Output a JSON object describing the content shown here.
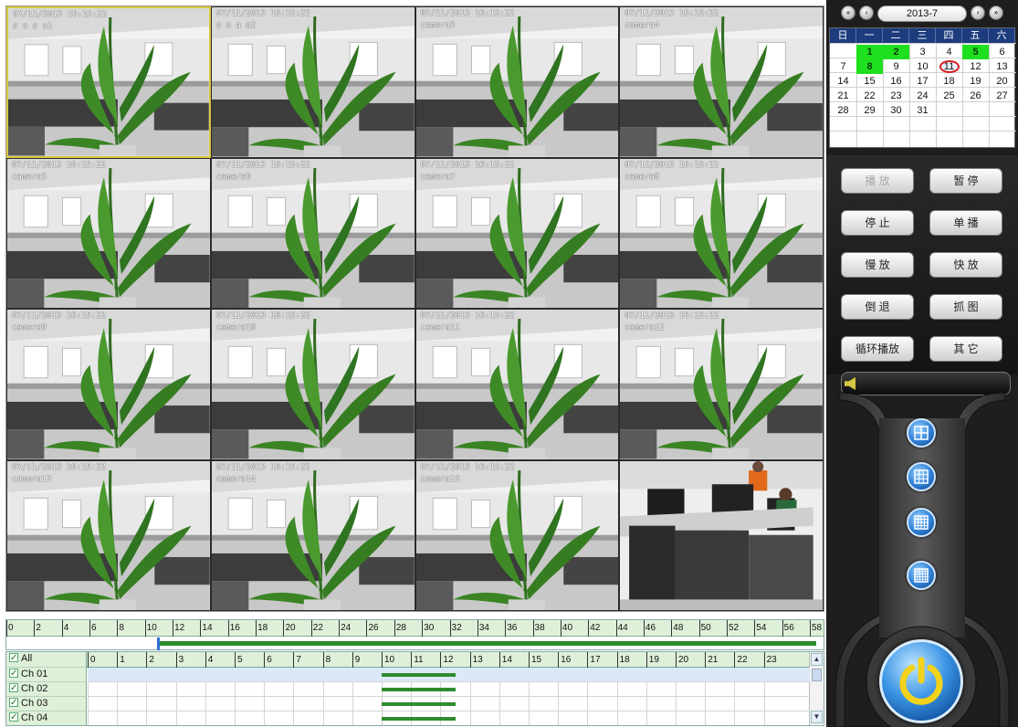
{
  "video_wall": {
    "tiles": [
      {
        "time": "07/11/2013 16:15:22",
        "name": "a a a a1"
      },
      {
        "time": "07/11/2013 16:15:22",
        "name": "a a a a2"
      },
      {
        "time": "07/11/2013 16:15:22",
        "name": "camera3"
      },
      {
        "time": "07/11/2013 16:15:22",
        "name": "camera4"
      },
      {
        "time": "07/11/2013 16:15:22",
        "name": "camera5"
      },
      {
        "time": "07/11/2013 16:15:22",
        "name": "camera6"
      },
      {
        "time": "07/11/2013 16:15:22",
        "name": "camera7"
      },
      {
        "time": "07/11/2013 16:15:22",
        "name": "camera8"
      },
      {
        "time": "07/11/2013 16:15:22",
        "name": "camera9"
      },
      {
        "time": "07/11/2013 16:15:22",
        "name": "camera10"
      },
      {
        "time": "07/11/2013 16:15:22",
        "name": "camera11"
      },
      {
        "time": "07/11/2013 16:15:22",
        "name": "camera12"
      },
      {
        "time": "07/11/2013 16:15:22",
        "name": "camera13"
      },
      {
        "time": "07/11/2013 16:15:22",
        "name": "camera14"
      },
      {
        "time": "07/11/2013 16:15:22",
        "name": "camera15"
      },
      {
        "time": "",
        "name": ""
      }
    ]
  },
  "calendar": {
    "month_label": "2013-7",
    "weekdays": [
      "日",
      "一",
      "二",
      "三",
      "四",
      "五",
      "六"
    ],
    "weeks": [
      [
        "",
        "1",
        "2",
        "3",
        "4",
        "5",
        "6"
      ],
      [
        "7",
        "8",
        "9",
        "10",
        "11",
        "12",
        "13"
      ],
      [
        "14",
        "15",
        "16",
        "17",
        "18",
        "19",
        "20"
      ],
      [
        "21",
        "22",
        "23",
        "24",
        "25",
        "26",
        "27"
      ],
      [
        "28",
        "29",
        "30",
        "31",
        "",
        "",
        ""
      ],
      [
        "",
        "",
        "",
        "",
        "",
        "",
        ""
      ]
    ],
    "recorded_days": [
      "1",
      "2",
      "5",
      "8"
    ],
    "today": "11",
    "nav": {
      "prev_year": "«",
      "prev_month": "‹",
      "next_month": "›",
      "next_year": "»"
    }
  },
  "controls": {
    "buttons": [
      {
        "label": "播 放",
        "disabled": true
      },
      {
        "label": "暂 停",
        "disabled": false
      },
      {
        "label": "停 止",
        "disabled": false
      },
      {
        "label": "单 播",
        "disabled": false
      },
      {
        "label": "慢 放",
        "disabled": false
      },
      {
        "label": "快 放",
        "disabled": false
      },
      {
        "label": "倒 退",
        "disabled": false
      },
      {
        "label": "抓 图",
        "disabled": false
      },
      {
        "label": "循环播放",
        "disabled": false
      },
      {
        "label": "其 它",
        "disabled": false
      }
    ],
    "split_buttons": [
      "split-4-icon",
      "split-9-icon",
      "split-16-icon",
      "split-25-icon"
    ]
  },
  "timeline": {
    "ruler_ticks": [
      "0",
      "2",
      "4",
      "6",
      "8",
      "10",
      "12",
      "14",
      "16",
      "18",
      "20",
      "22",
      "24",
      "26",
      "28",
      "30",
      "32",
      "34",
      "36",
      "38",
      "40",
      "42",
      "44",
      "46",
      "48",
      "50",
      "52",
      "54",
      "56",
      "58"
    ],
    "hour_ticks": [
      "0",
      "1",
      "2",
      "3",
      "4",
      "5",
      "6",
      "7",
      "8",
      "9",
      "10",
      "11",
      "12",
      "13",
      "14",
      "15",
      "16",
      "17",
      "18",
      "19",
      "20",
      "21",
      "22",
      "23"
    ],
    "all_label": "All",
    "channels": [
      {
        "label": "Ch 01",
        "rec_start": 10.0,
        "rec_end": 12.5
      },
      {
        "label": "Ch 02",
        "rec_start": 10.0,
        "rec_end": 12.5
      },
      {
        "label": "Ch 03",
        "rec_start": 10.0,
        "rec_end": 12.5
      },
      {
        "label": "Ch 04",
        "rec_start": 10.0,
        "rec_end": 12.5
      }
    ],
    "scrollbar": {
      "up": "▲",
      "down": "▼"
    }
  }
}
